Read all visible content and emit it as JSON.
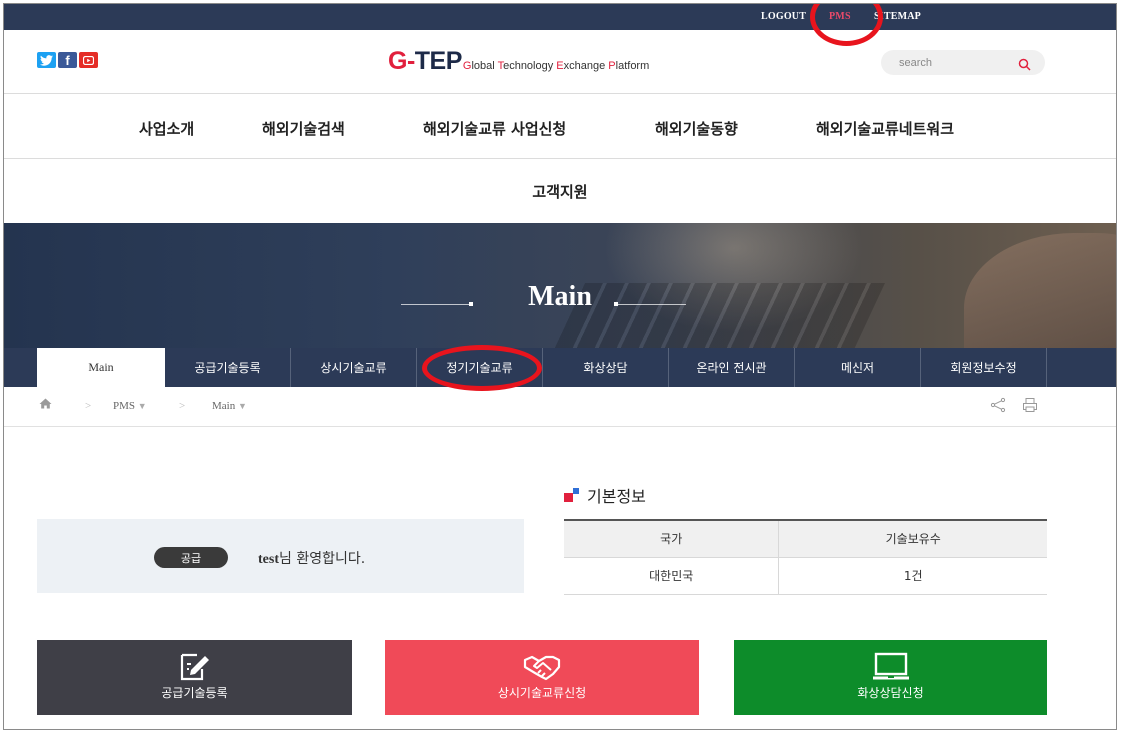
{
  "util": {
    "logout": "LOGOUT",
    "pms": "PMS",
    "sitemap": "SITEMAP"
  },
  "header": {
    "social": [
      "twitter-icon",
      "facebook-icon",
      "youtube-icon"
    ],
    "facebook_glyph": "f",
    "logo": {
      "main_g": "G-",
      "main_tep": "TEP",
      "sub": [
        {
          "accent": "G",
          "rest": "lobal "
        },
        {
          "accent": "T",
          "rest": "echnology "
        },
        {
          "accent": "E",
          "rest": "xchange "
        },
        {
          "accent": "P",
          "rest": "latform"
        }
      ]
    },
    "search_placeholder": "search"
  },
  "gnb": {
    "items": [
      "사업소개",
      "해외기술검색",
      "해외기술교류 사업신청",
      "해외기술동향",
      "해외기술교류네트워크"
    ],
    "row2": "고객지원"
  },
  "banner": {
    "title": "Main"
  },
  "subtabs": [
    "Main",
    "공급기술등록",
    "상시기술교류",
    "정기기술교류",
    "화상상담",
    "온라인 전시관",
    "메신저",
    "회원정보수정"
  ],
  "breadcrumb": {
    "level1": "PMS",
    "level2": "Main"
  },
  "welcome": {
    "badge": "공급",
    "user": "test",
    "suffix": "님 환영합니다."
  },
  "info": {
    "title": "기본정보",
    "headers": [
      "국가",
      "기술보유수"
    ],
    "rows": [
      [
        "대한민국",
        "1건"
      ]
    ]
  },
  "quick": [
    {
      "label": "공급기술등록",
      "icon": "edit-document-icon",
      "color": "#3f3f47"
    },
    {
      "label": "상시기술교류신청",
      "icon": "handshake-icon",
      "color": "#f04a58"
    },
    {
      "label": "화상상담신청",
      "icon": "monitor-icon",
      "color": "#0d8c2a"
    }
  ],
  "colors": {
    "navy": "#2c3a57",
    "accent_red": "#e1203d",
    "annotation_circle": "#e8141d"
  }
}
